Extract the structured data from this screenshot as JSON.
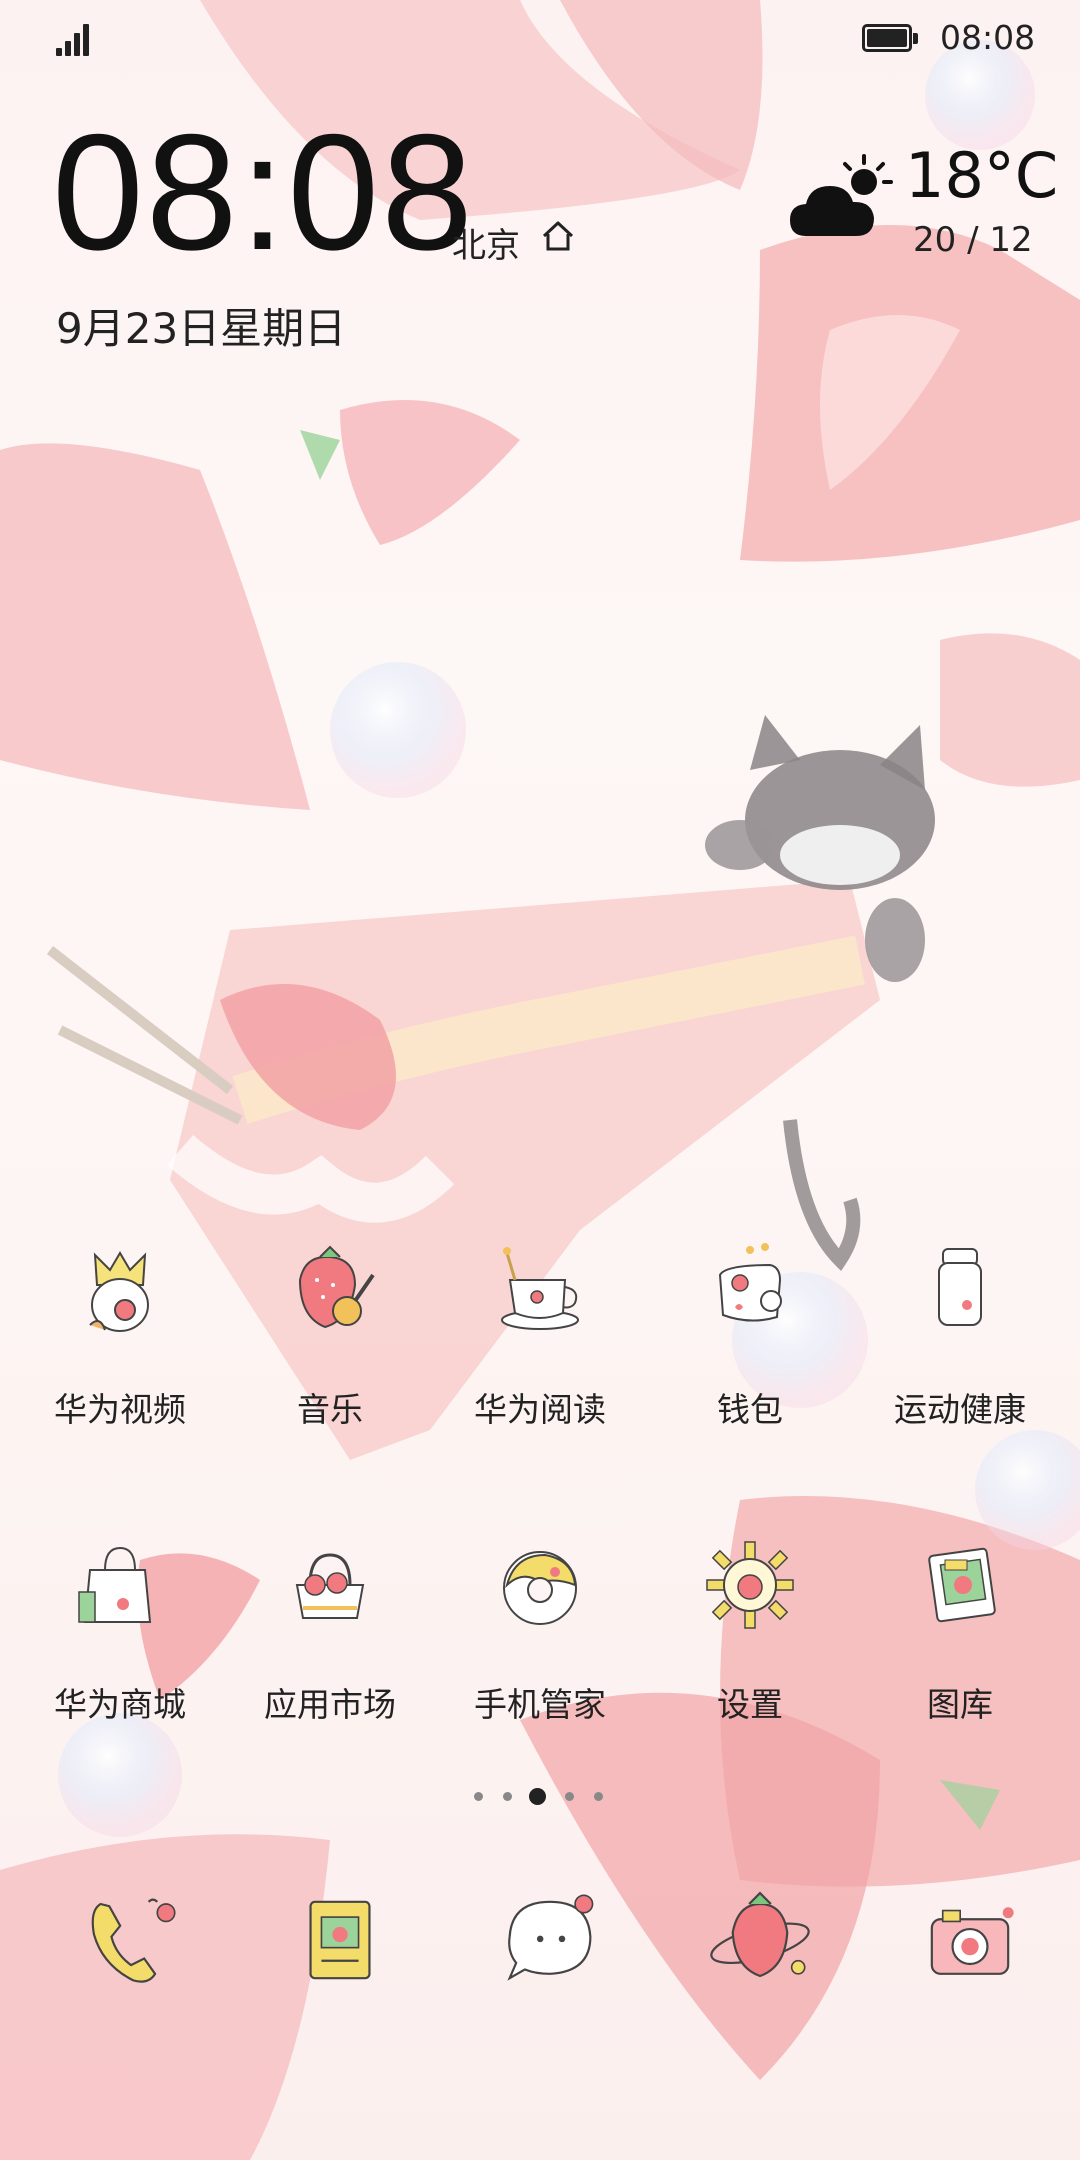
{
  "status_bar": {
    "signal_icon": "signal-strength-icon",
    "battery_icon": "battery-full-icon",
    "time": "08:08"
  },
  "clock_widget": {
    "time": "08:08",
    "city": "北京",
    "city_icon": "home-icon",
    "date": "9月23日星期日"
  },
  "weather_widget": {
    "icon": "partly-cloudy-icon",
    "temperature": "18°C",
    "range": "20 / 12"
  },
  "apps_row1": [
    {
      "label": "华为视频",
      "icon": "video-icon"
    },
    {
      "label": "音乐",
      "icon": "music-icon"
    },
    {
      "label": "华为阅读",
      "icon": "reading-icon"
    },
    {
      "label": "钱包",
      "icon": "wallet-icon"
    },
    {
      "label": "运动健康",
      "icon": "health-icon"
    }
  ],
  "apps_row2": [
    {
      "label": "华为商城",
      "icon": "store-icon"
    },
    {
      "label": "应用市场",
      "icon": "app-market-icon"
    },
    {
      "label": "手机管家",
      "icon": "phone-manager-icon"
    },
    {
      "label": "设置",
      "icon": "settings-icon"
    },
    {
      "label": "图库",
      "icon": "gallery-icon"
    }
  ],
  "page_indicator": {
    "count": 5,
    "active_index": 2
  },
  "dock": [
    {
      "icon": "phone-icon"
    },
    {
      "icon": "contacts-icon"
    },
    {
      "icon": "messages-icon"
    },
    {
      "icon": "browser-icon"
    },
    {
      "icon": "camera-icon"
    }
  ],
  "colors": {
    "strawberry": "#f29a9e",
    "strawberry_light": "#f7c5c6",
    "leaf": "#8bcf8f",
    "text": "#222222"
  }
}
